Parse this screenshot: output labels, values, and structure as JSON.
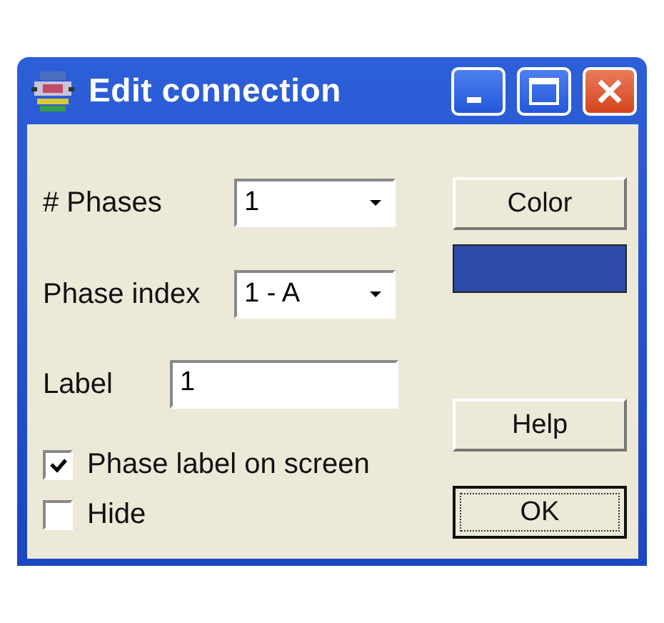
{
  "window": {
    "title": "Edit connection"
  },
  "fields": [
    {
      "kind": "dropdown",
      "label": "# Phases",
      "value": "1"
    },
    {
      "kind": "dropdown",
      "label": "Phase index",
      "value": "1 - A"
    },
    {
      "kind": "text",
      "label": "Label",
      "value": "1"
    }
  ],
  "checkboxes": [
    {
      "label": "Phase label on screen",
      "checked": true
    },
    {
      "label": "Hide",
      "checked": false
    }
  ],
  "color_button": {
    "label": "Color",
    "color": "#2b4ba6"
  },
  "buttons": [
    {
      "label": "Help",
      "default": false
    },
    {
      "label": "OK",
      "default": true
    }
  ]
}
